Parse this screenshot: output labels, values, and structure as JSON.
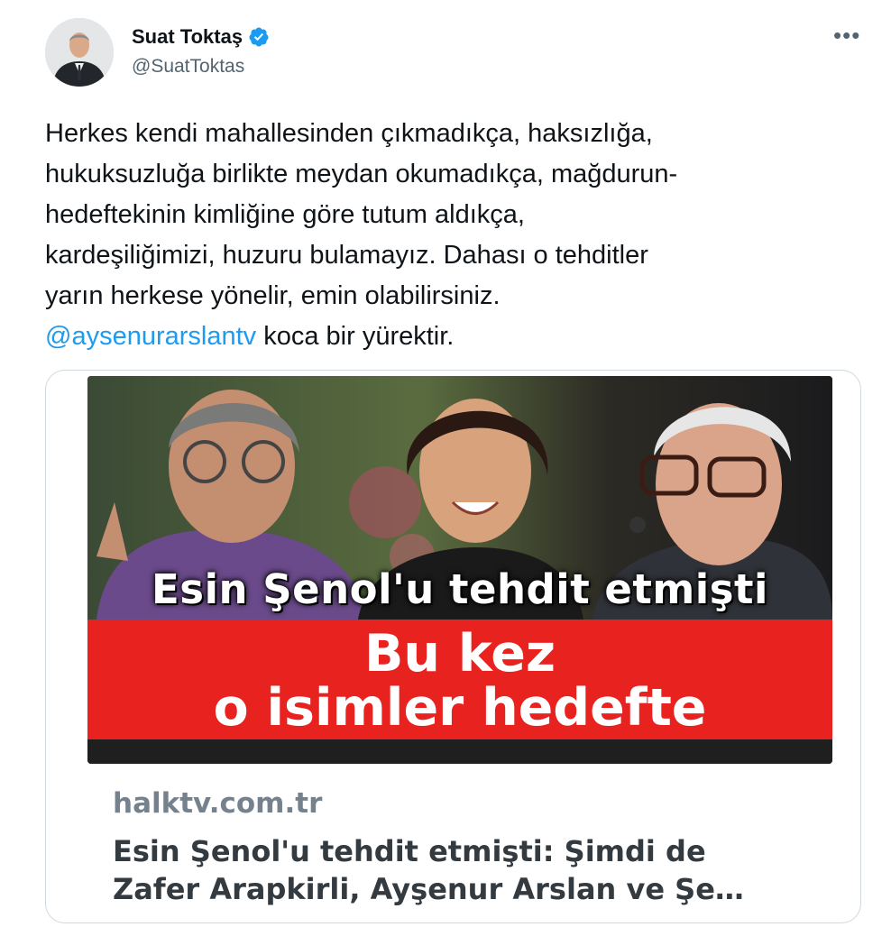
{
  "author": {
    "name": "Suat Toktaş",
    "handle": "@SuatToktas"
  },
  "more_label": "•••",
  "tweet": {
    "line1": "Herkes kendi mahallesinden çıkmadıkça, haksızlığa,",
    "line2": "hukuksuzluğa birlikte meydan okumadıkça, mağdurun-",
    "line3": "hedeftekinin kimliğine göre tutum aldıkça,",
    "line4": "kardeşiliğimizi, huzuru bulamayız. Dahası o tehditler",
    "line5": "yarın herkese yönelir, emin olabilirsiniz.",
    "mention": "@aysenurarslantv",
    "line6_rest": " koca bir yürektir."
  },
  "card": {
    "image_headline_top": "Esin Şenol'u tehdit etmişti",
    "image_headline_red_1": "Bu kez",
    "image_headline_red_2": "o isimler hedefte",
    "domain": "halktv.com.tr",
    "title_line1": "Esin Şenol'u tehdit etmişti: Şimdi de",
    "title_line2": "Zafer Arapkirli, Ayşenur Arslan ve Şe…"
  },
  "colors": {
    "mention": "#1d9bf0",
    "verified": "#1d9bf0",
    "red_band": "#e8221f"
  },
  "icons": [
    "verified-badge-icon",
    "more-options-icon"
  ]
}
